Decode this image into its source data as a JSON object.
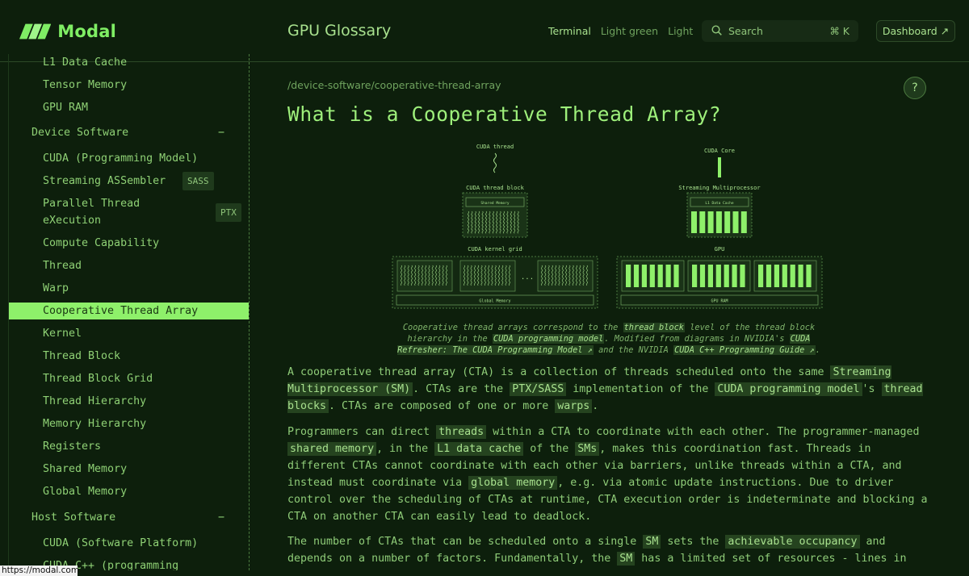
{
  "brand": {
    "name": "Modal"
  },
  "header": {
    "title": "GPU Glossary",
    "themes": [
      "Terminal",
      "Light green",
      "Light"
    ],
    "search": {
      "placeholder": "Search",
      "shortcut": "⌘ K"
    },
    "dashboard": "Dashboard ↗"
  },
  "sidebar": {
    "items": [
      {
        "label": "L1 Data Cache"
      },
      {
        "label": "Tensor Memory"
      },
      {
        "label": "GPU RAM"
      },
      {
        "label": "Device Software",
        "toggle": "−"
      },
      {
        "label": "CUDA (Programming Model)"
      },
      {
        "label": "Streaming ASSembler",
        "badge": "SASS"
      },
      {
        "label": "Parallel Thread",
        "label2": "eXecution",
        "badge": "PTX"
      },
      {
        "label": "Compute Capability"
      },
      {
        "label": "Thread"
      },
      {
        "label": "Warp"
      },
      {
        "label": "Cooperative Thread Array"
      },
      {
        "label": "Kernel"
      },
      {
        "label": "Thread Block"
      },
      {
        "label": "Thread Block Grid"
      },
      {
        "label": "Thread Hierarchy"
      },
      {
        "label": "Memory Hierarchy"
      },
      {
        "label": "Registers"
      },
      {
        "label": "Shared Memory"
      },
      {
        "label": "Global Memory"
      },
      {
        "label": "Host Software",
        "toggle": "−"
      },
      {
        "label": "CUDA (Software Platform)"
      },
      {
        "label": "CUDA C++ (programming"
      }
    ]
  },
  "status_url": "https://modal.com",
  "main": {
    "breadcrumb": "/device-software/cooperative-thread-array",
    "help": "?",
    "title": "What is a Cooperative Thread Array?",
    "diagram": {
      "cuda_thread": "CUDA thread",
      "cuda_core": "CUDA Core",
      "cuda_thread_block": "CUDA thread block",
      "streaming_multiprocessor": "Streaming Multiprocessor",
      "shared_memory": "Shared Memory",
      "l1_data_cache": "L1 Data Cache",
      "cuda_kernel_grid": "CUDA kernel grid",
      "gpu": "GPU",
      "global_memory": "Global Memory",
      "gpu_ram": "GPU RAM",
      "ellipsis": "..."
    },
    "caption": {
      "t1": "Cooperative thread arrays correspond to the ",
      "l1": "thread block",
      "t2": " level of the thread block hierarchy in the ",
      "l2": "CUDA programming model",
      "t3": ". Modified from diagrams in NVIDIA's ",
      "l3": "CUDA Refresher: The CUDA Programming Model ↗",
      "t4": " and the NVIDIA ",
      "l4": "CUDA C++ Programming Guide ↗",
      "t5": "."
    },
    "p1": {
      "t1": "A cooperative thread array (CTA) is a collection of threads scheduled onto the same ",
      "l1": "Streaming Multiprocessor (SM)",
      "t2": ". CTAs are the ",
      "l2": "PTX/SASS",
      "t3": " implementation of the ",
      "l3": "CUDA programming model",
      "t4": "'s ",
      "l4": "thread blocks",
      "t5": ". CTAs are composed of one or more ",
      "l5": "warps",
      "t6": "."
    },
    "p2": {
      "t1": "Programmers can direct ",
      "l1": "threads",
      "t2": " within a CTA to coordinate with each other. The programmer-managed ",
      "l2": "shared memory",
      "t3": ", in the ",
      "l3": "L1 data cache",
      "t4": " of the ",
      "l4": "SMs",
      "t5": ", makes this coordination fast. Threads in different CTAs cannot coordinate with each other via barriers, unlike threads within a CTA, and instead must coordinate via ",
      "l5": "global memory",
      "t6": ", e.g. via atomic update instructions. Due to driver control over the scheduling of CTAs at runtime, CTA execution order is indeterminate and blocking a CTA on another CTA can easily lead to deadlock."
    },
    "p3": {
      "t1": "The number of CTAs that can be scheduled onto a single ",
      "l1": "SM",
      "t2": " sets the ",
      "l2": "achievable occupancy",
      "t3": " and depends on a number of factors. Fundamentally, the ",
      "l3": "SM",
      "t4": " has a limited set of resources - lines in"
    }
  }
}
